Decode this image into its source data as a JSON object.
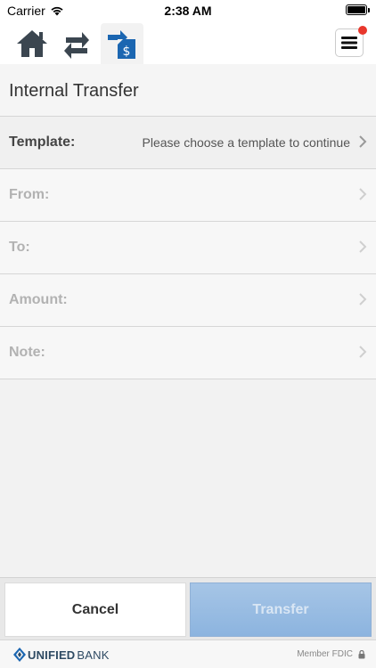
{
  "status_bar": {
    "carrier": "Carrier",
    "time": "2:38 AM"
  },
  "nav": {
    "tabs": [
      {
        "icon": "home-icon"
      },
      {
        "icon": "transfer-arrows-icon"
      },
      {
        "icon": "dollar-transfer-icon",
        "active": true
      }
    ],
    "menu_icon": "hamburger-menu-icon",
    "notification_color": "#e8372c"
  },
  "page": {
    "title": "Internal Transfer"
  },
  "form": {
    "template_label": "Template:",
    "template_value": "Please choose a template to continue",
    "from_label": "From:",
    "to_label": "To:",
    "amount_label": "Amount:",
    "note_label": "Note:"
  },
  "buttons": {
    "cancel": "Cancel",
    "transfer": "Transfer"
  },
  "footer": {
    "brand_bold": "UNIFIED",
    "brand_light": "BANK",
    "member": "Member FDIC"
  },
  "colors": {
    "accent": "#1b66b1",
    "icon_dark": "#3b4650",
    "transfer_button": "#99bce2"
  }
}
